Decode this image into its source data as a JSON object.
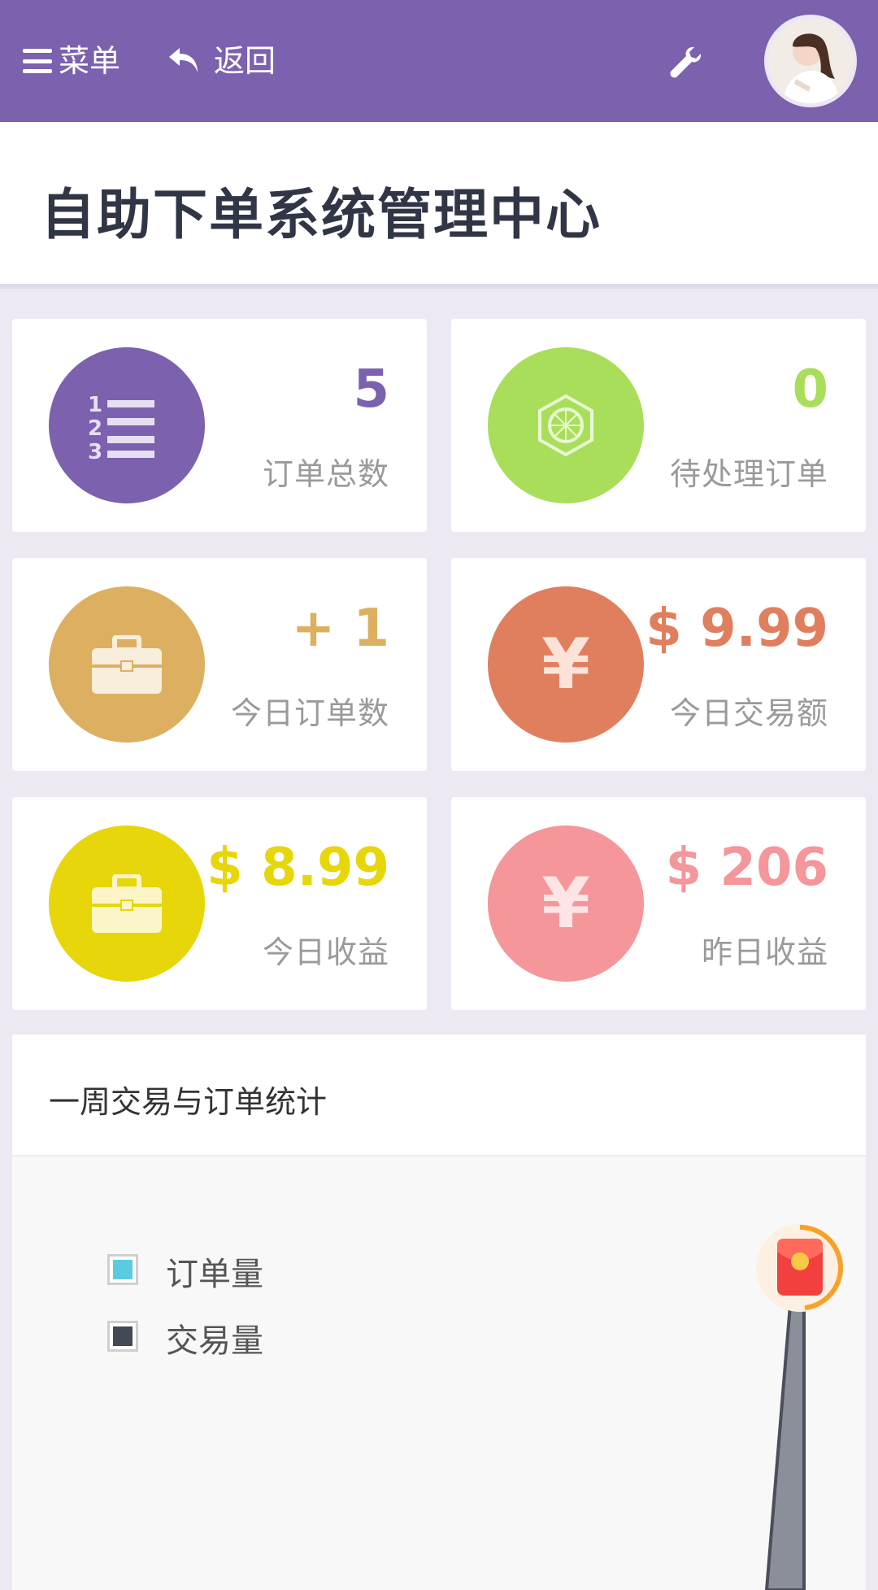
{
  "header": {
    "menu_label": "菜单",
    "back_label": "返回",
    "bg_color": "#7b61ae"
  },
  "page_title": "自助下单系统管理中心",
  "stats": [
    {
      "value": "5",
      "label": "订单总数",
      "color": "#7b61ae",
      "icon": "numbered-list-icon"
    },
    {
      "value": "0",
      "label": "待处理订单",
      "color": "#a9de5b",
      "icon": "hexagon-badge-icon"
    },
    {
      "value": "+ 1",
      "label": "今日订单数",
      "color": "#dcb060",
      "icon": "briefcase-icon"
    },
    {
      "value": "$ 9.99",
      "label": "今日交易额",
      "color": "#e07f5e",
      "icon": "yen-icon"
    },
    {
      "value": "$ 8.99",
      "label": "今日收益",
      "color": "#e6d60a",
      "icon": "briefcase-icon"
    },
    {
      "value": "$ 206",
      "label": "昨日收益",
      "color": "#f4969a",
      "icon": "yen-icon"
    }
  ],
  "chart_panel": {
    "title": "一周交易与订单统计",
    "legend": [
      {
        "name": "订单量",
        "color": "#5bcbe0"
      },
      {
        "name": "交易量",
        "color": "#434a54"
      }
    ]
  }
}
